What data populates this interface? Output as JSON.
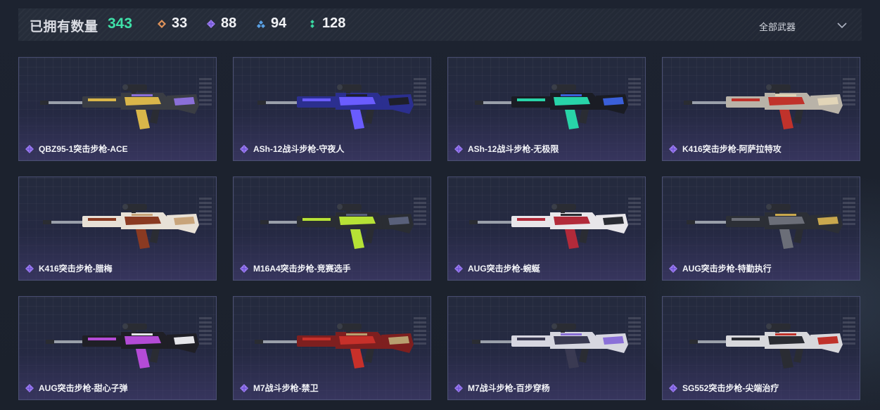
{
  "header": {
    "owned_label": "已拥有数量",
    "owned_count": "343",
    "stats": [
      {
        "icon": "orange-diamond-icon",
        "value": "33",
        "color": "#e0935a"
      },
      {
        "icon": "purple-diamond-icon",
        "value": "88",
        "color": "#9b7bf0"
      },
      {
        "icon": "blue-diamond-icon",
        "value": "94",
        "color": "#5aa2e6"
      },
      {
        "icon": "green-dots-icon",
        "value": "128",
        "color": "#39d6a0"
      }
    ],
    "filter": {
      "label": "全部武器"
    }
  },
  "accent": {
    "owned": "#3fe0a8",
    "rarity_purple": "#9b7bf0"
  },
  "weapons": [
    {
      "name": "QBZ95-1突击步枪-ACE",
      "body": "#3a3d44",
      "accent": "#d9b64a",
      "accent2": "#8a6fd8"
    },
    {
      "name": "ASh-12战斗步枪-守夜人",
      "body": "#2b2f8f",
      "accent": "#6a5cff",
      "accent2": "#1e1f2a"
    },
    {
      "name": "ASh-12战斗步枪-无极限",
      "body": "#1a1c24",
      "accent": "#28d4a8",
      "accent2": "#3a5fd9"
    },
    {
      "name": "K416突击步枪-阿萨拉特攻",
      "body": "#b9b3a8",
      "accent": "#c0322b",
      "accent2": "#e2d5b8"
    },
    {
      "name": "K416突击步枪-腊梅",
      "body": "#e8e1d6",
      "accent": "#8a3a22",
      "accent2": "#c8a47a"
    },
    {
      "name": "M16A4突击步枪-竞赛选手",
      "body": "#2a2d33",
      "accent": "#b6e236",
      "accent2": "#59607a"
    },
    {
      "name": "AUG突击步枪-蜿蜒",
      "body": "#e8e6ea",
      "accent": "#b22a3a",
      "accent2": "#2a2c33"
    },
    {
      "name": "AUG突击步枪-特勤执行",
      "body": "#2c2f36",
      "accent": "#6b6e78",
      "accent2": "#c9a84e"
    },
    {
      "name": "AUG突击步枪-甜心子弹",
      "body": "#1f1f26",
      "accent": "#b44bd6",
      "accent2": "#e6e6ea"
    },
    {
      "name": "M7战斗步枪-禁卫",
      "body": "#7e1f1f",
      "accent": "#c7302a",
      "accent2": "#b8a070"
    },
    {
      "name": "M7战斗步枪-百步穿杨",
      "body": "#d6d6e0",
      "accent": "#3a3a52",
      "accent2": "#8a6fd8"
    },
    {
      "name": "SG552突击步枪-尖端治疗",
      "body": "#d8d8dc",
      "accent": "#2a2c33",
      "accent2": "#c0322b"
    }
  ]
}
